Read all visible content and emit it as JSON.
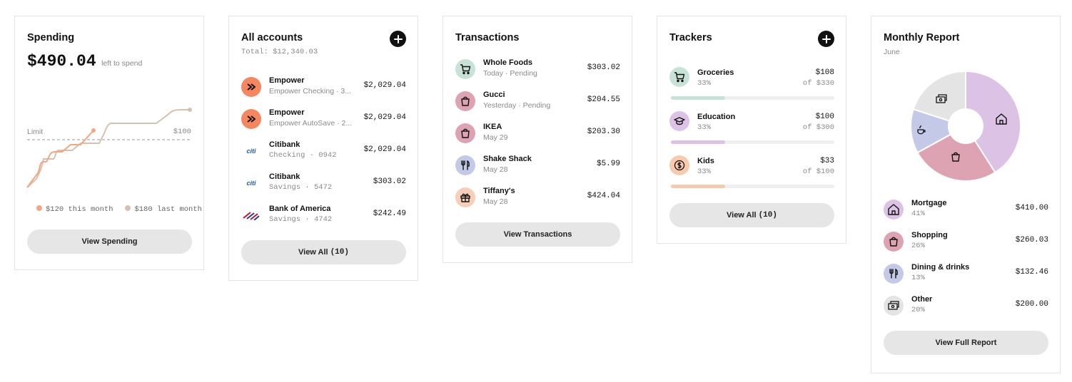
{
  "spending": {
    "title": "Spending",
    "amount": "$490.04",
    "amount_caption": "left to spend",
    "limit_label": "Limit",
    "limit_value": "$100",
    "legend_this": "$120 this month",
    "legend_last": "$180 last month",
    "button": "View Spending",
    "colors": {
      "this_month": "#f4a582",
      "last_month": "#d8c0b0"
    }
  },
  "accounts": {
    "title": "All accounts",
    "total": "Total: $12,340.03",
    "add_icon": "plus-icon",
    "items": [
      {
        "name": "Empower",
        "detail": "Empower Checking · 3...",
        "amount": "$2,029.04",
        "icon": "empower-logo"
      },
      {
        "name": "Empower",
        "detail": "Empower AutoSave · 2...",
        "amount": "$2,029.04",
        "icon": "empower-logo"
      },
      {
        "name": "Citibank",
        "detail": "Checking · 0942",
        "amount": "$2,029.04",
        "icon": "citi-logo",
        "logo_text": "citi"
      },
      {
        "name": "Citibank",
        "detail": "Savings · 5472",
        "amount": "$303.02",
        "icon": "citi-logo",
        "logo_text": "citi"
      },
      {
        "name": "Bank of America",
        "detail": "Savings · 4742",
        "amount": "$242.49",
        "icon": "bank-of-america-logo"
      }
    ],
    "button_label": "View All",
    "button_count": "(10)"
  },
  "transactions": {
    "title": "Transactions",
    "items": [
      {
        "name": "Whole Foods",
        "detail": "Today · Pending",
        "amount": "$303.02",
        "icon": "cart-icon",
        "color": "#c7e3d8"
      },
      {
        "name": "Gucci",
        "detail": "Yesterday · Pending",
        "amount": "$204.55",
        "icon": "shopping-bag-icon",
        "color": "#dea3b3"
      },
      {
        "name": "IKEA",
        "detail": "May 29",
        "amount": "$203.30",
        "icon": "shopping-bag-icon",
        "color": "#dea3b3"
      },
      {
        "name": "Shake Shack",
        "detail": "May 28",
        "amount": "$5.99",
        "icon": "fork-knife-icon",
        "color": "#c4c9e8"
      },
      {
        "name": "Tiffany's",
        "detail": "May 28",
        "amount": "$424.04",
        "icon": "gift-icon",
        "color": "#f7cfb8"
      }
    ],
    "button": "View Transactions"
  },
  "trackers": {
    "title": "Trackers",
    "add_icon": "plus-icon",
    "items": [
      {
        "name": "Groceries",
        "pct": "33%",
        "amount": "$108",
        "of": "of $330",
        "progress": 0.33,
        "icon": "cart-icon",
        "color": "#c7e3d8"
      },
      {
        "name": "Education",
        "pct": "33%",
        "amount": "$100",
        "of": "of $300",
        "progress": 0.33,
        "icon": "graduation-cap-icon",
        "color": "#dcc3e6"
      },
      {
        "name": "Kids",
        "pct": "33%",
        "amount": "$33",
        "of": "of $100",
        "progress": 0.33,
        "icon": "coin-icon",
        "color": "#f7c9ae"
      }
    ],
    "button_label": "View All",
    "button_count": "(10)"
  },
  "report": {
    "title": "Monthly Report",
    "month": "June",
    "items": [
      {
        "name": "Mortgage",
        "pct": "41%",
        "amount": "$410.00",
        "icon": "house-icon",
        "color": "#dcc3e6"
      },
      {
        "name": "Shopping",
        "pct": "26%",
        "amount": "$260.03",
        "icon": "shopping-bag-icon",
        "color": "#dea3b3"
      },
      {
        "name": "Dining & drinks",
        "pct": "13%",
        "amount": "$132.46",
        "icon": "fork-knife-icon",
        "color": "#c4c9e8"
      },
      {
        "name": "Other",
        "pct": "20%",
        "amount": "$200.00",
        "icon": "money-icon",
        "color": "#e4e4e4"
      }
    ],
    "button": "View Full Report"
  }
}
